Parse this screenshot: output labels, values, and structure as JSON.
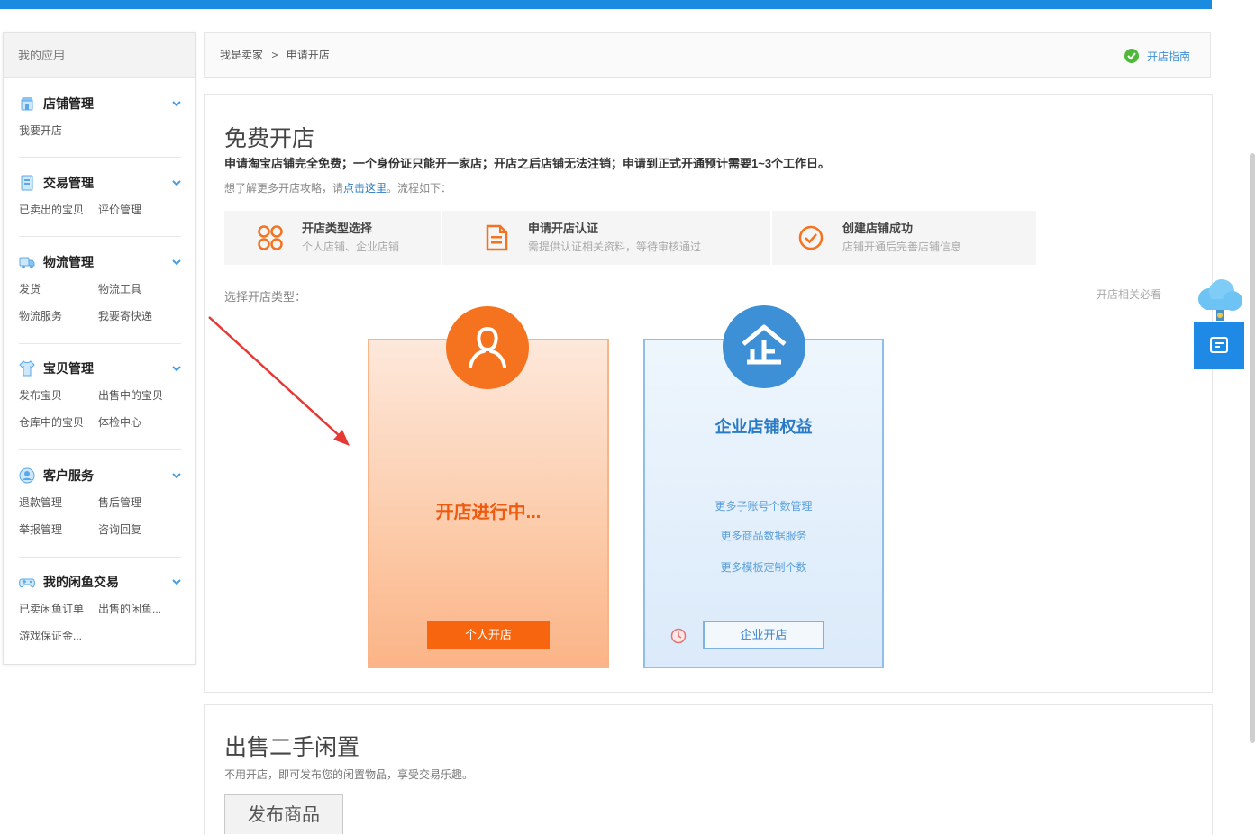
{
  "colors": {
    "top_bar": "#1a8be0",
    "personal_orange": "#f5731e",
    "enterprise_blue": "#3d8fd6",
    "link_blue": "#2a7bc5",
    "annotation_red": "#e53935"
  },
  "sidebar": {
    "header": "我的应用",
    "sections": [
      {
        "title": "店铺管理",
        "icon": "store-icon",
        "links": [
          "我要开店"
        ]
      },
      {
        "title": "交易管理",
        "icon": "trade-icon",
        "links": [
          "已卖出的宝贝",
          "评价管理"
        ]
      },
      {
        "title": "物流管理",
        "icon": "logistics-icon",
        "links": [
          "发货",
          "物流工具",
          "物流服务",
          "我要寄快递"
        ]
      },
      {
        "title": "宝贝管理",
        "icon": "goods-icon",
        "links": [
          "发布宝贝",
          "出售中的宝贝",
          "仓库中的宝贝",
          "体检中心"
        ]
      },
      {
        "title": "客户服务",
        "icon": "customer-service-icon",
        "links": [
          "退款管理",
          "售后管理",
          "举报管理",
          "咨询回复"
        ]
      },
      {
        "title": "我的闲鱼交易",
        "icon": "idle-fish-icon",
        "links": [
          "已卖闲鱼订单",
          "出售的闲鱼...",
          "游戏保证金..."
        ]
      }
    ]
  },
  "breadcrumb": {
    "root": "我是卖家",
    "separator": ">",
    "current": "申请开店"
  },
  "guide_link": {
    "label": "开店指南",
    "icon": "guide-icon"
  },
  "open_store": {
    "title": "免费开店",
    "desc": "申请淘宝店铺完全免费；一个身份证只能开一家店；开店之后店铺无法注销；申请到正式开通预计需要1~3个工作日。",
    "desc2_prefix": "想了解更多开店攻略，请",
    "desc2_link": "点击这里",
    "desc2_suffix": "。流程如下：",
    "steps": [
      {
        "title": "开店类型选择",
        "desc": "个人店铺、企业店铺",
        "icon": "four-circles-icon"
      },
      {
        "title": "申请开店认证",
        "desc": "需提供认证相关资料，等待审核通过",
        "icon": "document-icon"
      },
      {
        "title": "创建店铺成功",
        "desc": "店铺开通后完善店铺信息",
        "icon": "check-circle-icon"
      }
    ],
    "choose_label": "选择开店类型：",
    "must_read": "开店相关必看",
    "personal": {
      "status": "开店进行中...",
      "button": "个人开店",
      "icon": "person-icon"
    },
    "enterprise": {
      "title": "企业店铺权益",
      "benefits": [
        "更多子账号个数管理",
        "更多商品数据服务",
        "更多模板定制个数"
      ],
      "button": "企业开店",
      "icon": "enterprise-icon"
    }
  },
  "secondhand": {
    "title": "出售二手闲置",
    "desc": "不用开店，即可发布您的闲置物品，享受交易乐趣。",
    "button": "发布商品"
  },
  "widget": {
    "icons": [
      "cloud-mascot-icon",
      "chat-icon"
    ]
  }
}
